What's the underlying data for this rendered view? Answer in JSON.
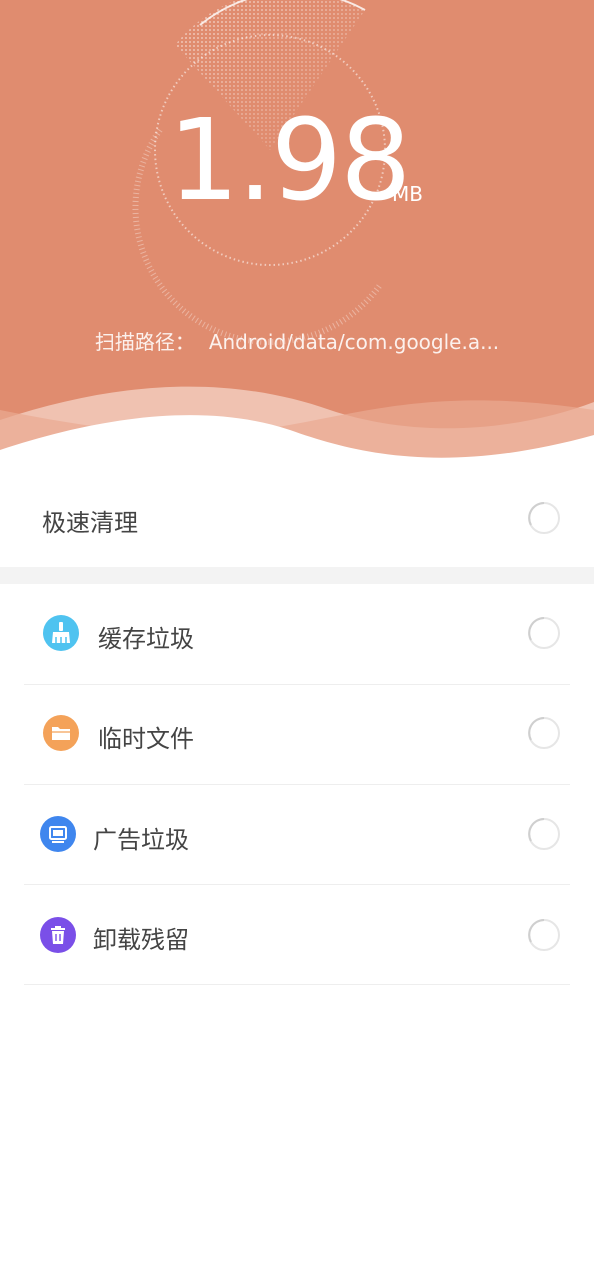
{
  "scan": {
    "size_value": "1.98",
    "size_unit": "MB",
    "path_label": "扫描路径：",
    "path_value": "Android/data/com.google.a..."
  },
  "quick_clean": {
    "label": "极速清理"
  },
  "categories": [
    {
      "label": "缓存垃圾",
      "icon": "broom-icon",
      "color": "#4fc3f0"
    },
    {
      "label": "临时文件",
      "icon": "folder-icon",
      "color": "#f4a259"
    },
    {
      "label": "广告垃圾",
      "icon": "monitor-icon",
      "color": "#3f86ee"
    },
    {
      "label": "卸载残留",
      "icon": "trash-icon",
      "color": "#7a4fe8"
    }
  ],
  "colors": {
    "hero_bg": "#e08c6f",
    "text": "#444444"
  }
}
